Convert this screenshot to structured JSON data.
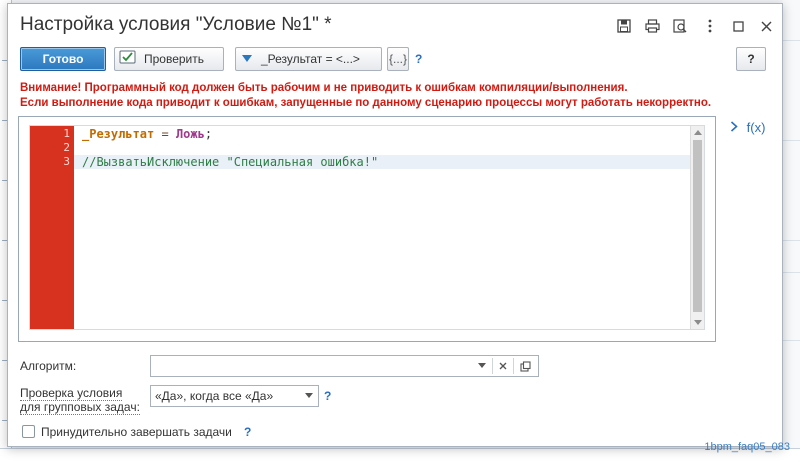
{
  "dialog": {
    "title": "Настройка условия \"Условие №1\" *"
  },
  "toolbar": {
    "done_label": "Готово",
    "check_label": "Проверить",
    "result_label": "_Результат = <...>",
    "braces_label": "{...}",
    "help_mark": "?",
    "help_button_label": "?"
  },
  "warning": {
    "line1": "Внимание! Программный код должен быть рабочим и не приводить к ошибкам компиляции/выполнения.",
    "line2": "Если выполнение кода приводит к ошибкам, запущенные по данному сценарию процессы могут работать некорректно."
  },
  "editor": {
    "line_numbers": [
      "1",
      "2",
      "3"
    ],
    "line1": {
      "var": "_Результат",
      "op": " = ",
      "bool": "Ложь",
      "punc": ";"
    },
    "line3": "//ВызватьИсключение \"Специальная ошибка!\""
  },
  "fx_label": "f(x)",
  "fields": {
    "algorithm": {
      "label": "Алгоритм:",
      "value": ""
    },
    "group_check": {
      "label_line1": "Проверка условия",
      "label_line2": "для групповых задач:",
      "value": "«Да», когда все «Да»",
      "help": "?"
    },
    "force_finish": {
      "label": "Принудительно завершать задачи",
      "help": "?",
      "checked": false
    }
  },
  "watermark": "1bpm_faq05_083",
  "colors": {
    "primary": "#2c78bf",
    "warning": "#d01b12",
    "gutter": "#d7321f",
    "link": "#2a6fc0"
  }
}
